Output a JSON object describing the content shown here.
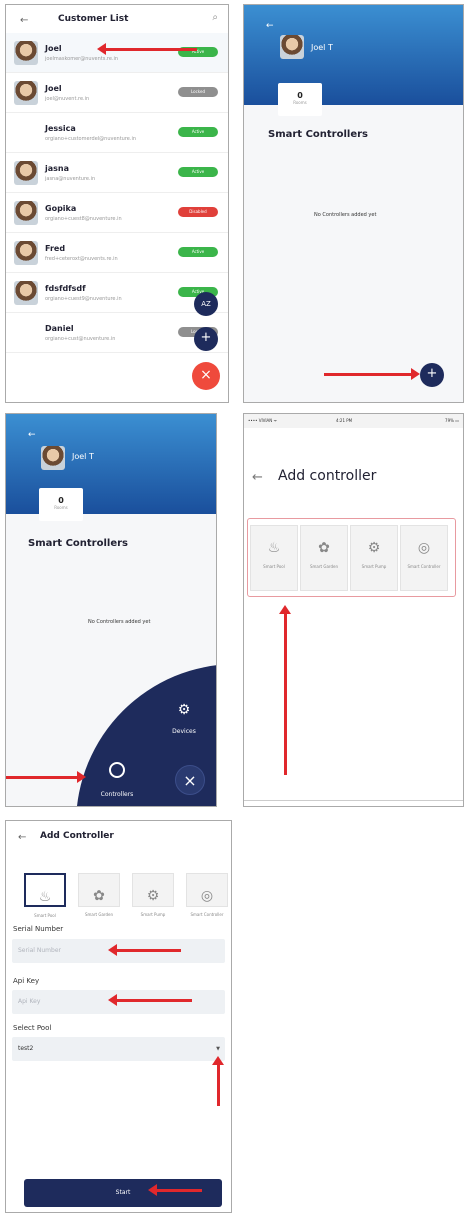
{
  "panel1": {
    "title": "Customer List",
    "customers": [
      {
        "name": "Joel",
        "email": "joelmaskomer@nuvents.re.in",
        "status": "Active",
        "color": "green",
        "avatar": true
      },
      {
        "name": "Joel",
        "email": "joel@nuvent.re.in",
        "status": "Locked",
        "color": "gray",
        "avatar": true
      },
      {
        "name": "Jessica",
        "email": "orgiano+customerdel@nuventure.in",
        "status": "Active",
        "color": "green",
        "avatar": false
      },
      {
        "name": "jasna",
        "email": "jasna@nuventure.in",
        "status": "Active",
        "color": "green",
        "avatar": true
      },
      {
        "name": "Gopika",
        "email": "orgiano+cuest8@nuventure.in",
        "status": "Disabled",
        "color": "red",
        "avatar": true
      },
      {
        "name": "Fred",
        "email": "fred+ceteroxt@nuvents.re.in",
        "status": "Active",
        "color": "green",
        "avatar": true
      },
      {
        "name": "fdsfdfsdf",
        "email": "orgiano+cuest9@nuventure.in",
        "status": "Active",
        "color": "green",
        "avatar": true
      },
      {
        "name": "Daniel",
        "email": "orgiano+cust@nuventure.in",
        "status": "Locked",
        "color": "gray",
        "avatar": false
      }
    ],
    "fab_az": "AZ",
    "fab_plus": "+",
    "fab_close": "×"
  },
  "panel2": {
    "user": "Joel T",
    "count": "0",
    "count_label": "Rooms",
    "section": "Smart Controllers",
    "empty": "No Controllers added yet",
    "fab_plus": "+"
  },
  "panel3": {
    "user": "Joel T",
    "count": "0",
    "count_label": "Rooms",
    "section": "Smart Controllers",
    "empty": "No Controllers added yet",
    "devices": "Devices",
    "controllers": "Controllers",
    "close": "×"
  },
  "panel4": {
    "status_left": "•••• VIVIAN ᯤ",
    "status_time": "4:21 PM",
    "status_right": "79% ▭",
    "title": "Add controller",
    "tiles": [
      "Smart Pool",
      "Smart Garden",
      "Smart Pump",
      "Smart Controller"
    ]
  },
  "panel5": {
    "title": "Add Controller",
    "tiles": [
      "Smart Pool",
      "Smart Garden",
      "Smart Pump",
      "Smart Controller"
    ],
    "serial_label": "Serial Number",
    "serial_placeholder": "Serial Number",
    "api_label": "Api Key",
    "api_placeholder": "Api Key",
    "pool_label": "Select Pool",
    "pool_value": "test2",
    "start": "Start"
  }
}
